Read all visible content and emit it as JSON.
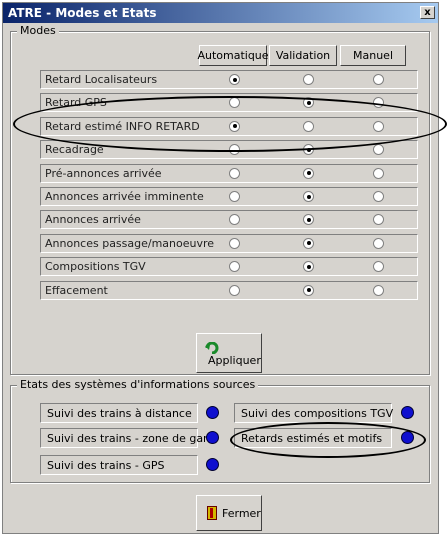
{
  "window": {
    "title": "ATRE - Modes et Etats",
    "close_label": "x"
  },
  "modes": {
    "legend": "Modes",
    "columns": [
      "Automatique",
      "Validation",
      "Manuel"
    ],
    "rows": [
      {
        "label": "Retard Localisateurs",
        "selected": 0
      },
      {
        "label": "Retard GPS",
        "selected": 1
      },
      {
        "label": "Retard estimé INFO RETARD",
        "selected": 0
      },
      {
        "label": "Recadrage",
        "selected": 1
      },
      {
        "label": "Pré-annonces arrivée",
        "selected": 1
      },
      {
        "label": "Annonces arrivée imminente",
        "selected": 1
      },
      {
        "label": "Annonces arrivée",
        "selected": 1
      },
      {
        "label": "Annonces passage/manoeuvre",
        "selected": 1
      },
      {
        "label": "Compositions TGV",
        "selected": 1
      },
      {
        "label": "Effacement",
        "selected": 1
      }
    ],
    "apply_label": "Appliquer"
  },
  "sources": {
    "legend": "Etats des systèmes d'informations sources",
    "items": [
      {
        "label": "Suivi des trains à distance",
        "color": "#0f0fcf"
      },
      {
        "label": "Suivi des compositions TGV",
        "color": "#0f0fcf"
      },
      {
        "label": "Suivi des trains - zone de gare",
        "color": "#0f0fcf"
      },
      {
        "label": "Retards estimés et motifs",
        "color": "#0f0fcf"
      },
      {
        "label": "Suivi des trains - GPS",
        "color": "#0f0fcf"
      }
    ]
  },
  "footer": {
    "close_label": "Fermer"
  }
}
